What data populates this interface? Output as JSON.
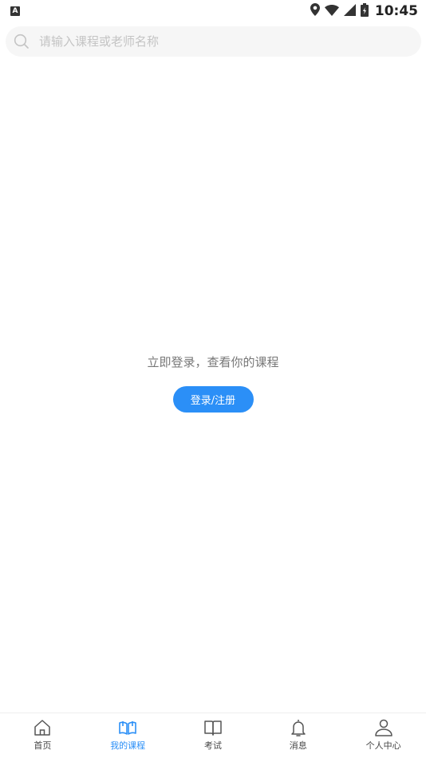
{
  "status_bar": {
    "notification_badge": "A",
    "time": "10:45",
    "icons": [
      "location-icon",
      "wifi-icon",
      "signal-icon",
      "battery-icon"
    ]
  },
  "search": {
    "placeholder": "请输入课程或老师名称",
    "value": ""
  },
  "empty_state": {
    "prompt": "立即登录，查看你的课程",
    "button_label": "登录/注册"
  },
  "tab_bar": {
    "tabs": [
      {
        "label": "首页",
        "icon": "home-icon",
        "active": false
      },
      {
        "label": "我的课程",
        "icon": "open-book-icon",
        "active": true
      },
      {
        "label": "考试",
        "icon": "book-icon",
        "active": false
      },
      {
        "label": "消息",
        "icon": "bell-icon",
        "active": false
      },
      {
        "label": "个人中心",
        "icon": "person-icon",
        "active": false
      }
    ]
  },
  "colors": {
    "accent": "#2b8ff7",
    "tab_text": "#444444",
    "placeholder": "#c4c4c4",
    "prompt_text": "#777777"
  }
}
